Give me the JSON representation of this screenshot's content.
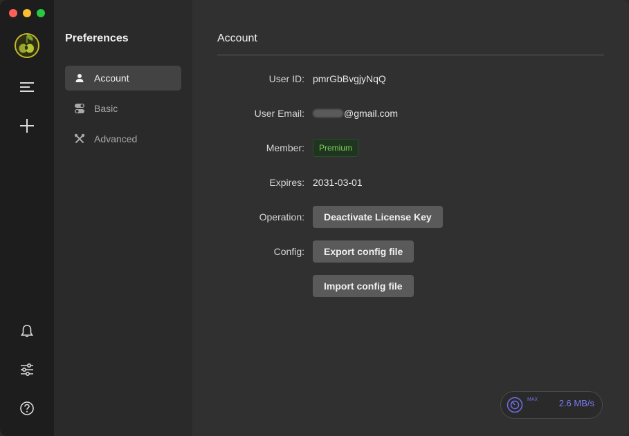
{
  "colors": {
    "close": "#ff5f57",
    "minimize": "#febc2e",
    "zoom": "#28c840",
    "accent": "#7b7df5",
    "badge_text": "#7ecf5a"
  },
  "rail": {
    "logo_icon": "olive-logo-icon",
    "menu_icon": "menu-lines-icon",
    "add_icon": "plus-icon",
    "bell_icon": "bell-icon",
    "sliders_icon": "sliders-icon",
    "help_icon": "question-icon"
  },
  "sidebar": {
    "title": "Preferences",
    "items": [
      {
        "label": "Account",
        "icon": "person-icon",
        "active": true
      },
      {
        "label": "Basic",
        "icon": "toggle-icon",
        "active": false
      },
      {
        "label": "Advanced",
        "icon": "wrench-icon",
        "active": false
      }
    ]
  },
  "account": {
    "title": "Account",
    "user_id_label": "User ID:",
    "user_id": "pmrGbBvgjyNqQ",
    "email_label": "User Email:",
    "email_suffix": "@gmail.com",
    "member_label": "Member:",
    "member_value": "Premium",
    "expires_label": "Expires:",
    "expires_value": "2031-03-01",
    "operation_label": "Operation:",
    "deactivate_button": "Deactivate License Key",
    "config_label": "Config:",
    "export_button": "Export config file",
    "import_button": "Import config file"
  },
  "speed_widget": {
    "max_label": "MAX",
    "speed": "2.6 MB/s"
  }
}
